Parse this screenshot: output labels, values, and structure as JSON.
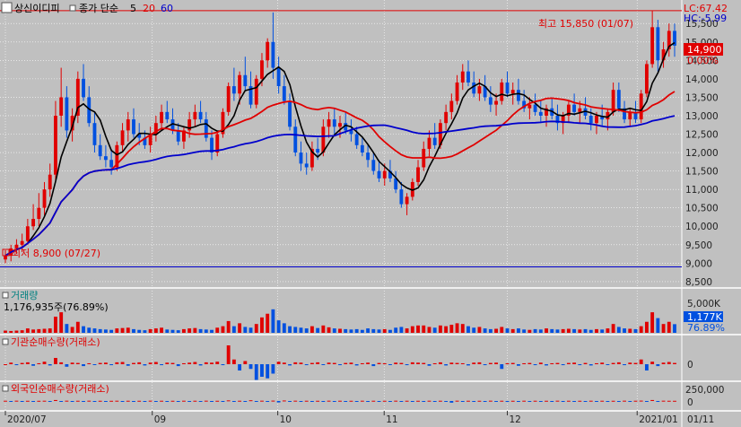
{
  "header": {
    "stock_name": "상신이디피",
    "ma_label": "종가 단순",
    "ma_periods": [
      "5",
      "20",
      "60"
    ],
    "ma_colors": [
      "#000000",
      "#e00000",
      "#0000cc"
    ]
  },
  "price_panel": {
    "lc_label": "LC:67.42",
    "hc_label": "HC:-5.99",
    "high_text": "최고 15,850 (01/07)",
    "low_text": "최저 8,900 (07/27)",
    "current_price": "14,900",
    "current_pct": "0.00%",
    "y_ticks": [
      "15,500",
      "15,000",
      "14,500",
      "14,000",
      "13,500",
      "13,000",
      "12,500",
      "12,000",
      "11,500",
      "11,000",
      "10,500",
      "10,000",
      "9,500",
      "9,000",
      "8,500"
    ]
  },
  "volume_panel": {
    "title": "거래량",
    "detail": "1,176,935주(76.89%)",
    "y_tick": "5,000K",
    "current": "1,177K",
    "pct": "76.89%"
  },
  "inst_panel": {
    "title": "기관순매수량(거래소)",
    "y_tick": "0"
  },
  "foreign_panel": {
    "title": "외국인순매수량(거래소)",
    "y_ticks": [
      "250,000",
      "0"
    ]
  },
  "x_axis": {
    "labels": [
      "2020/07",
      "09",
      "10",
      "11",
      "12",
      "2021/01"
    ],
    "right_label": "01/11"
  },
  "colors": {
    "up": "#e00000",
    "down": "#0050e0",
    "background": "#c0c0c0"
  },
  "chart_data": [
    {
      "type": "candlestick",
      "title": "",
      "ylabel": "",
      "ylim": [
        8400,
        15700
      ],
      "series": [
        {
          "name": "5",
          "values": []
        },
        {
          "name": "20",
          "values": []
        },
        {
          "name": "60",
          "values": []
        }
      ],
      "x": [
        "2020/07",
        "09",
        "10",
        "11",
        "12",
        "2021/01"
      ],
      "ohlc": [
        [
          9100,
          9350,
          9000,
          9200
        ],
        [
          9200,
          9500,
          9050,
          9400
        ],
        [
          9400,
          9650,
          9250,
          9500
        ],
        [
          9500,
          9800,
          9300,
          9600
        ],
        [
          9600,
          10200,
          9500,
          10000
        ],
        [
          10000,
          10600,
          9900,
          10200
        ],
        [
          10200,
          10900,
          10000,
          10500
        ],
        [
          10500,
          11200,
          10300,
          11000
        ],
        [
          11000,
          11700,
          10800,
          11400
        ],
        [
          11400,
          13400,
          11200,
          13000
        ],
        [
          13000,
          14300,
          12700,
          13500
        ],
        [
          13500,
          13800,
          12400,
          12600
        ],
        [
          12600,
          13200,
          12300,
          13000
        ],
        [
          13000,
          14200,
          12800,
          14000
        ],
        [
          14000,
          14400,
          13400,
          13500
        ],
        [
          13500,
          13800,
          12700,
          12800
        ],
        [
          12800,
          13100,
          12000,
          12200
        ],
        [
          12200,
          12500,
          11800,
          11900
        ],
        [
          11900,
          12200,
          11600,
          11800
        ],
        [
          11800,
          12100,
          11400,
          11600
        ],
        [
          11600,
          12300,
          11500,
          12200
        ],
        [
          12200,
          12800,
          12000,
          12600
        ],
        [
          12600,
          13100,
          12300,
          12900
        ],
        [
          12900,
          13200,
          12400,
          12500
        ],
        [
          12500,
          12800,
          12200,
          12400
        ],
        [
          12400,
          12600,
          12100,
          12200
        ],
        [
          12200,
          12700,
          12000,
          12500
        ],
        [
          12500,
          13000,
          12300,
          12800
        ],
        [
          12800,
          13300,
          12600,
          13100
        ],
        [
          13100,
          13400,
          12800,
          12900
        ],
        [
          12900,
          13200,
          12500,
          12600
        ],
        [
          12600,
          12800,
          12200,
          12300
        ],
        [
          12300,
          12700,
          12100,
          12600
        ],
        [
          12600,
          13100,
          12400,
          12900
        ],
        [
          12900,
          13300,
          12700,
          13100
        ],
        [
          13100,
          13400,
          12800,
          12900
        ],
        [
          12900,
          13100,
          12300,
          12400
        ],
        [
          12400,
          12600,
          11800,
          12000
        ],
        [
          12000,
          12600,
          11900,
          12500
        ],
        [
          12500,
          13200,
          12400,
          13100
        ],
        [
          13100,
          13900,
          13000,
          13800
        ],
        [
          13800,
          14300,
          13400,
          13600
        ],
        [
          13600,
          14200,
          13300,
          14100
        ],
        [
          14100,
          14600,
          13700,
          13800
        ],
        [
          13800,
          14200,
          13200,
          13300
        ],
        [
          13300,
          14100,
          13200,
          14000
        ],
        [
          14000,
          14700,
          13800,
          14500
        ],
        [
          14500,
          15100,
          14300,
          15000
        ],
        [
          15000,
          15800,
          14000,
          14300
        ],
        [
          14300,
          14600,
          13600,
          13800
        ],
        [
          13800,
          14100,
          13300,
          13400
        ],
        [
          13400,
          13600,
          12600,
          12700
        ],
        [
          12700,
          12900,
          11900,
          12000
        ],
        [
          12000,
          12300,
          11500,
          11700
        ],
        [
          11700,
          12000,
          11400,
          11600
        ],
        [
          11600,
          12300,
          11500,
          12100
        ],
        [
          12100,
          12400,
          11800,
          12000
        ],
        [
          12000,
          12900,
          11900,
          12700
        ],
        [
          12700,
          13100,
          12400,
          12900
        ],
        [
          12900,
          13200,
          12500,
          12700
        ],
        [
          12700,
          13000,
          12400,
          12800
        ],
        [
          12800,
          13100,
          12500,
          12600
        ],
        [
          12600,
          12900,
          12300,
          12500
        ],
        [
          12500,
          12700,
          12100,
          12200
        ],
        [
          12200,
          12400,
          11900,
          12000
        ],
        [
          12000,
          12200,
          11600,
          11800
        ],
        [
          11800,
          12000,
          11400,
          11500
        ],
        [
          11500,
          11800,
          11200,
          11300
        ],
        [
          11300,
          11700,
          11100,
          11500
        ],
        [
          11500,
          11800,
          11200,
          11300
        ],
        [
          11300,
          11500,
          10900,
          11000
        ],
        [
          11000,
          11200,
          10500,
          10600
        ],
        [
          10600,
          10900,
          10300,
          10800
        ],
        [
          10800,
          11300,
          10700,
          11200
        ],
        [
          11200,
          11800,
          11100,
          11600
        ],
        [
          11600,
          12300,
          11500,
          12100
        ],
        [
          12100,
          12600,
          11900,
          12400
        ],
        [
          12400,
          12800,
          12100,
          12200
        ],
        [
          12200,
          12900,
          12100,
          12800
        ],
        [
          12800,
          13300,
          12600,
          13100
        ],
        [
          13100,
          13600,
          12900,
          13400
        ],
        [
          13400,
          14100,
          13300,
          13900
        ],
        [
          13900,
          14400,
          13700,
          14200
        ],
        [
          14200,
          14500,
          13800,
          13900
        ],
        [
          13900,
          14200,
          13500,
          13600
        ],
        [
          13600,
          14000,
          13400,
          13800
        ],
        [
          13800,
          14100,
          13400,
          13500
        ],
        [
          13500,
          13800,
          13100,
          13300
        ],
        [
          13300,
          13600,
          13000,
          13400
        ],
        [
          13400,
          14000,
          13300,
          13900
        ],
        [
          13900,
          14200,
          13500,
          13600
        ],
        [
          13600,
          13900,
          13300,
          13700
        ],
        [
          13700,
          14000,
          13300,
          13400
        ],
        [
          13400,
          13700,
          13100,
          13200
        ],
        [
          13200,
          13500,
          12900,
          13300
        ],
        [
          13300,
          13600,
          13000,
          13100
        ],
        [
          13100,
          13400,
          12800,
          13000
        ],
        [
          13000,
          13300,
          12700,
          13200
        ],
        [
          13200,
          13500,
          12900,
          13000
        ],
        [
          13000,
          13300,
          12600,
          12800
        ],
        [
          12800,
          13100,
          12500,
          13000
        ],
        [
          13000,
          13400,
          12800,
          13300
        ],
        [
          13300,
          13600,
          13000,
          13100
        ],
        [
          13100,
          13400,
          12800,
          13200
        ],
        [
          13200,
          13500,
          12900,
          13000
        ],
        [
          13000,
          13200,
          12600,
          12800
        ],
        [
          12800,
          13100,
          12500,
          13000
        ],
        [
          13000,
          13300,
          12700,
          12900
        ],
        [
          12900,
          13200,
          12600,
          13100
        ],
        [
          13100,
          13900,
          13000,
          13700
        ],
        [
          13700,
          13900,
          13100,
          13200
        ],
        [
          13200,
          13400,
          12800,
          12900
        ],
        [
          12900,
          13200,
          12700,
          13100
        ],
        [
          13100,
          13400,
          12800,
          12900
        ],
        [
          12900,
          13700,
          12800,
          13600
        ],
        [
          13600,
          14500,
          13500,
          14400
        ],
        [
          14400,
          15850,
          14300,
          15400
        ],
        [
          15400,
          15600,
          14200,
          14500
        ],
        [
          14500,
          15000,
          14300,
          14800
        ],
        [
          14800,
          15500,
          14600,
          15300
        ],
        [
          15300,
          15500,
          14600,
          14900
        ]
      ]
    },
    {
      "type": "bar",
      "title": "거래량",
      "unit": "K",
      "ylim": [
        0,
        5500
      ],
      "values": [
        300,
        250,
        300,
        350,
        600,
        450,
        500,
        550,
        600,
        2200,
        2800,
        1200,
        800,
        1500,
        900,
        700,
        600,
        500,
        450,
        400,
        600,
        650,
        700,
        500,
        400,
        350,
        500,
        600,
        700,
        450,
        400,
        350,
        500,
        600,
        650,
        500,
        450,
        400,
        700,
        900,
        1600,
        900,
        1300,
        800,
        700,
        1200,
        2100,
        2600,
        3200,
        1700,
        1300,
        900,
        800,
        700,
        600,
        900,
        650,
        1000,
        750,
        600,
        550,
        500,
        450,
        500,
        400,
        600,
        500,
        450,
        500,
        400,
        700,
        800,
        600,
        900,
        1000,
        1000,
        800,
        700,
        1000,
        900,
        1100,
        1300,
        1200,
        900,
        700,
        800,
        600,
        500,
        550,
        800,
        600,
        500,
        600,
        450,
        400,
        500,
        450,
        600,
        500,
        450,
        500,
        550,
        500,
        450,
        500,
        400,
        500,
        450,
        600,
        1200,
        800,
        600,
        550,
        500,
        900,
        1500,
        2800,
        2000,
        1200,
        1500,
        1177
      ]
    },
    {
      "type": "bar",
      "title": "기관순매수량(거래소)",
      "ylim": [
        -80000,
        80000
      ],
      "values": [
        0,
        5000,
        -3000,
        4000,
        6000,
        -5000,
        3000,
        8000,
        -4000,
        20000,
        6000,
        -8000,
        5000,
        4000,
        -6000,
        3000,
        -2000,
        4000,
        5000,
        -3000,
        6000,
        7000,
        -5000,
        4000,
        6000,
        -4000,
        5000,
        7000,
        -3000,
        5000,
        4000,
        -6000,
        3000,
        5000,
        7000,
        -4000,
        6000,
        5000,
        8000,
        -3000,
        60000,
        15000,
        -20000,
        10000,
        -15000,
        -50000,
        -40000,
        -45000,
        -30000,
        8000,
        5000,
        -4000,
        6000,
        5000,
        -3000,
        4000,
        6000,
        -2000,
        5000,
        4000,
        -3000,
        4000,
        5000,
        -4000,
        3000,
        5000,
        -6000,
        4000,
        3000,
        -2000,
        5000,
        4000,
        -3000,
        6000,
        5000,
        4000,
        -5000,
        3000,
        6000,
        -4000,
        5000,
        4000,
        3000,
        -4000,
        5000,
        6000,
        -3000,
        4000,
        5000,
        -15000,
        3000,
        4000,
        -5000,
        3000,
        4000,
        -3000,
        5000,
        -4000,
        3000,
        4000,
        -3000,
        4000,
        5000,
        -3000,
        4000,
        -4000,
        3000,
        5000,
        -2000,
        4000,
        6000,
        -3000,
        5000,
        4000,
        15000,
        -20000,
        8000,
        -6000,
        5000,
        7000,
        4000
      ]
    },
    {
      "type": "bar",
      "title": "외국인순매수량(거래소)",
      "ylim": [
        -260000,
        260000
      ],
      "values": [
        10000,
        -8000,
        12000,
        -5000,
        9000,
        -6000,
        8000,
        11000,
        -7000,
        40000,
        -30000,
        12000,
        -9000,
        10000,
        -8000,
        12000,
        -6000,
        9000,
        -7000,
        8000,
        11000,
        -6000,
        10000,
        -8000,
        9000,
        -5000,
        12000,
        -7000,
        10000,
        -6000,
        9000,
        -8000,
        11000,
        -5000,
        10000,
        -6000,
        12000,
        -7000,
        9000,
        -8000,
        25000,
        -12000,
        10000,
        -9000,
        30000,
        -15000,
        12000,
        -10000,
        15000,
        -60000,
        20000,
        -10000,
        12000,
        -8000,
        10000,
        -6000,
        9000,
        -7000,
        12000,
        -5000,
        10000,
        -8000,
        9000,
        -6000,
        11000,
        -7000,
        10000,
        -5000,
        9000,
        -8000,
        12000,
        -6000,
        10000,
        -7000,
        9000,
        -8000,
        11000,
        -6000,
        10000,
        -5000,
        -70000,
        12000,
        -8000,
        10000,
        -6000,
        9000,
        -7000,
        12000,
        -5000,
        10000,
        -8000,
        9000,
        -6000,
        11000,
        -7000,
        10000,
        -5000,
        9000,
        -8000,
        12000,
        -6000,
        10000,
        -7000,
        9000,
        -8000,
        11000,
        -6000,
        10000,
        -5000,
        9000,
        -8000,
        12000,
        -6000,
        10000,
        15000,
        -12000,
        40000,
        -10000,
        12000,
        9000,
        8000
      ]
    }
  ]
}
